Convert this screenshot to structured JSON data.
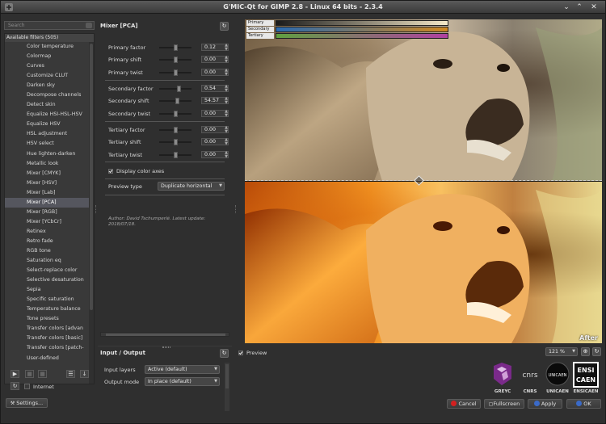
{
  "window": {
    "title": "G'MIC-Qt for GIMP 2.8 - Linux 64 bits - 2.3.4"
  },
  "left": {
    "search_placeholder": "Search",
    "category": "Available filters (505)",
    "filters": [
      "Color temperature",
      "Colormap",
      "Curves",
      "Customize CLUT",
      "Darken sky",
      "Decompose channels",
      "Detect skin",
      "Equalize HSI-HSL-HSV",
      "Equalize HSV",
      "HSL adjustment",
      "HSV select",
      "Hue lighten-darken",
      "Metallic look",
      "Mixer [CMYK]",
      "Mixer [HSV]",
      "Mixer [Lab]",
      "Mixer [PCA]",
      "Mixer [RGB]",
      "Mixer [YCbCr]",
      "Retinex",
      "Retro fade",
      "RGB tone",
      "Saturation eq",
      "Select-replace color",
      "Selective desaturation",
      "Sepia",
      "Specific saturation",
      "Temperature balance",
      "Tone presets",
      "Transfer colors [advan",
      "Transfer colors [basic]",
      "Transfer colors [patch-",
      "User-defined"
    ],
    "selected_index": 16,
    "internet_label": "Internet",
    "settings_label": "Settings..."
  },
  "filter": {
    "title": "Mixer [PCA]",
    "params": [
      {
        "label": "Primary factor",
        "value": "0.12",
        "level": 0.5
      },
      {
        "label": "Primary shift",
        "value": "0.00",
        "level": 0.5
      },
      {
        "label": "Primary twist",
        "value": "0.00",
        "level": 0.5
      },
      {
        "label": "Secondary factor",
        "value": "0.54",
        "level": 0.6
      },
      {
        "label": "Secondary shift",
        "value": "54.57",
        "level": 0.55
      },
      {
        "label": "Secondary twist",
        "value": "0.00",
        "level": 0.5
      },
      {
        "label": "Tertiary factor",
        "value": "0.00",
        "level": 0.5
      },
      {
        "label": "Tertiary shift",
        "value": "0.00",
        "level": 0.5
      },
      {
        "label": "Tertiary twist",
        "value": "0.00",
        "level": 0.5
      }
    ],
    "display_axes_label": "Display color axes",
    "preview_type_label": "Preview type",
    "preview_type_value": "Duplicate horizontal",
    "author": "Author: David Tschumperlé. Latest update: 2018/07/18."
  },
  "io": {
    "title": "Input / Output",
    "input_layers_label": "Input layers",
    "input_layers_value": "Active (default)",
    "output_mode_label": "Output mode",
    "output_mode_value": "In place (default)"
  },
  "preview": {
    "axes": [
      {
        "name": "Primary",
        "colors": [
          "#1a1a1a",
          "#f4e8c8"
        ]
      },
      {
        "name": "Secondary",
        "colors": [
          "#2a6ab0",
          "#d08820"
        ]
      },
      {
        "name": "Tertiary",
        "colors": [
          "#60a040",
          "#b040a0"
        ]
      }
    ],
    "after_label": "After",
    "preview_checkbox": "Preview",
    "zoom": "121 %"
  },
  "logos": [
    "GREYC",
    "CNRS",
    "UNICAEN",
    "ENSICAEN"
  ],
  "buttons": {
    "cancel": "Cancel",
    "fullscreen": "Fullscreen",
    "apply": "Apply",
    "ok": "OK"
  },
  "colors": {
    "bg": "#2f2f2f",
    "selected": "#55565e",
    "cancel_icon": "#d42020",
    "apply_icon": "#3a6ac8",
    "ok_icon": "#3a6ac8"
  }
}
